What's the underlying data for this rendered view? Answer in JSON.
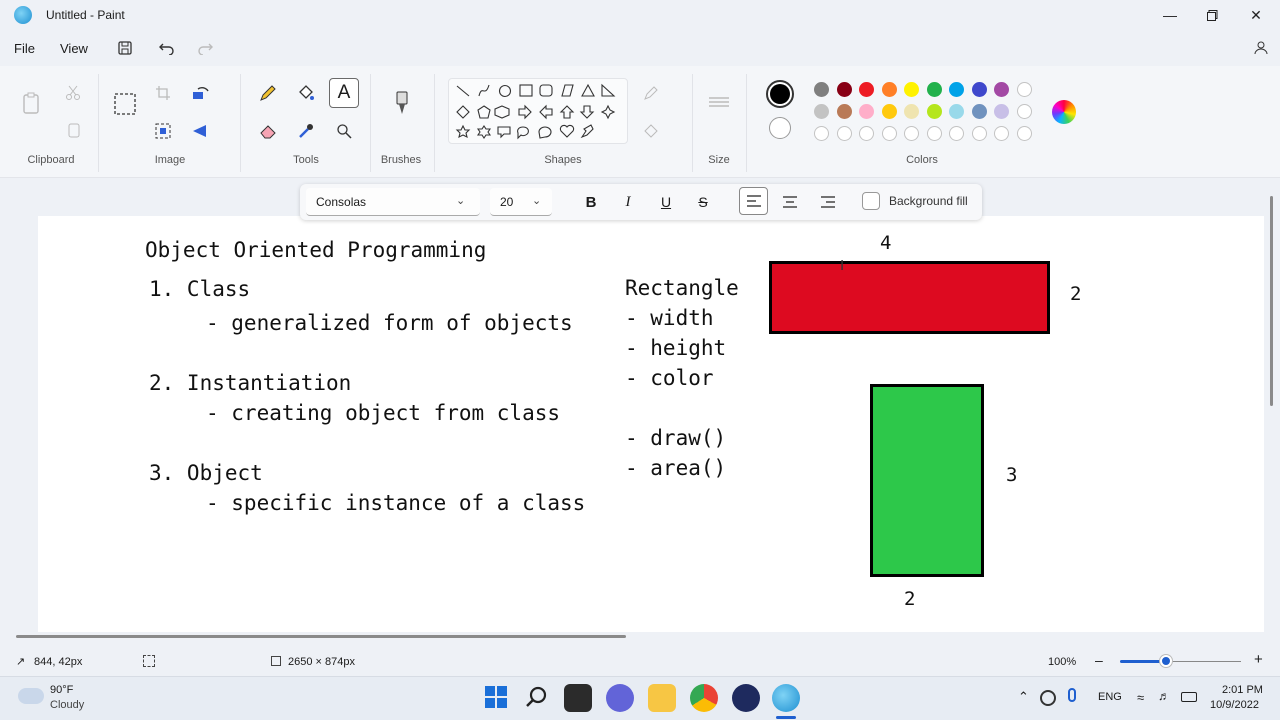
{
  "window": {
    "title": "Untitled - Paint"
  },
  "menu": {
    "file": "File",
    "view": "View"
  },
  "ribbon": {
    "clipboard": "Clipboard",
    "image": "Image",
    "tools": "Tools",
    "brushes": "Brushes",
    "shapes": "Shapes",
    "size": "Size",
    "colors": "Colors"
  },
  "colors": {
    "row1": [
      "#000000",
      "#7f7f7f",
      "#880015",
      "#ed1c24",
      "#ff7f27",
      "#fff200",
      "#22b14c",
      "#00a2e8",
      "#3f48cc",
      "#a349a4"
    ],
    "row2": [
      "#ffffff",
      "#c3c3c3",
      "#b97a57",
      "#ffaec9",
      "#ffc90e",
      "#efe4b0",
      "#b5e61d",
      "#99d9ea",
      "#7092be",
      "#c8bfe7"
    ],
    "primary": "#000000",
    "secondary": "#ffffff"
  },
  "format": {
    "font": "Consolas",
    "size": "20",
    "background_fill": "Background fill"
  },
  "canvas": {
    "title": "Object Oriented Programming",
    "l1": "1. Class",
    "l1a": "- generalized form of objects",
    "l2": "2. Instantiation",
    "l2a": "- creating object from class",
    "l3": "3. Object",
    "l3a": "- specific instance of a class",
    "rect_title": "Rectangle",
    "p1": "- width",
    "p2": "- height",
    "p3": "- color",
    "m1": "- draw()",
    "m2": "- area()",
    "red_w": "4",
    "red_h": "2",
    "green_h": "3",
    "green_w": "2",
    "red_color": "#dd0a20",
    "green_color": "#2dc84a"
  },
  "status": {
    "cursor": "844, 42px",
    "size": "2650 × 874px",
    "zoom": "100%"
  },
  "taskbar": {
    "temp": "90°F",
    "weather": "Cloudy",
    "lang": "ENG",
    "time": "2:01 PM",
    "date": "10/9/2022"
  }
}
